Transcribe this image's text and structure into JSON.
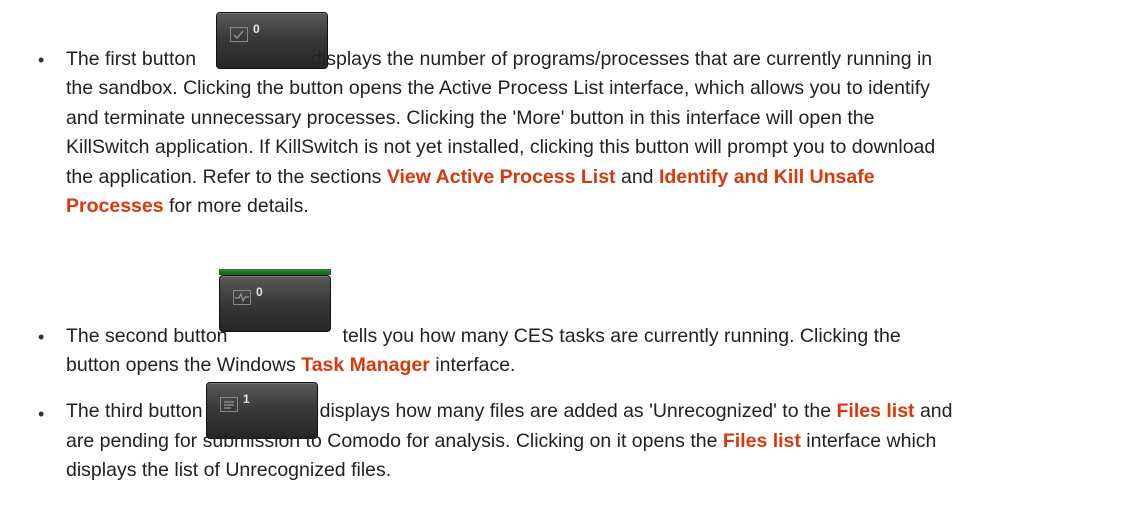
{
  "bullet_glyph": "•",
  "item1": {
    "line1_pre": "The first button",
    "line1_post": "displays the number of programs/processes that are currently running in",
    "button_count": "0",
    "button_icon": "check-window-icon",
    "line2": "the sandbox. Clicking the button opens the Active Process List interface, which allows you to identify",
    "line3": "and terminate unnecessary processes. Clicking the 'More' button in this interface will open the",
    "line4": "KillSwitch application. If KillSwitch is not yet installed, clicking this button will prompt you to download",
    "line5_pre": "the application. Refer to the sections ",
    "link_active": "View Active Process List",
    "line5_mid": " and ",
    "link_identify_a": "Identify and Kill Unsafe",
    "link_identify_b": "Processes",
    "line6_post": " for more details."
  },
  "item2": {
    "line1_pre": "The second button",
    "line1_post": "tells you how many CES tasks are currently running. Clicking the",
    "button_count": "0",
    "button_icon": "activity-monitor-icon",
    "line2_pre": "button opens the Windows ",
    "link_task": "Task Manager",
    "line2_post": " interface."
  },
  "item3": {
    "line1_pre": "The third button",
    "line1_mid": "displays how many files are added as 'Unrecognized' to the ",
    "link_files": "Files list",
    "line1_post": " and",
    "button_count": "1",
    "button_icon": "document-icon",
    "line2_pre": "are pending for submission to Comodo for analysis. Clicking on it opens the ",
    "link_files2": "Files list",
    "line2_post": " interface which",
    "line3": "displays the list of Unrecognized files."
  },
  "colors": {
    "link": "#d8380c",
    "text": "#222222",
    "button_bg": "#3a3a3a",
    "green_strip": "#2e8a2a"
  }
}
